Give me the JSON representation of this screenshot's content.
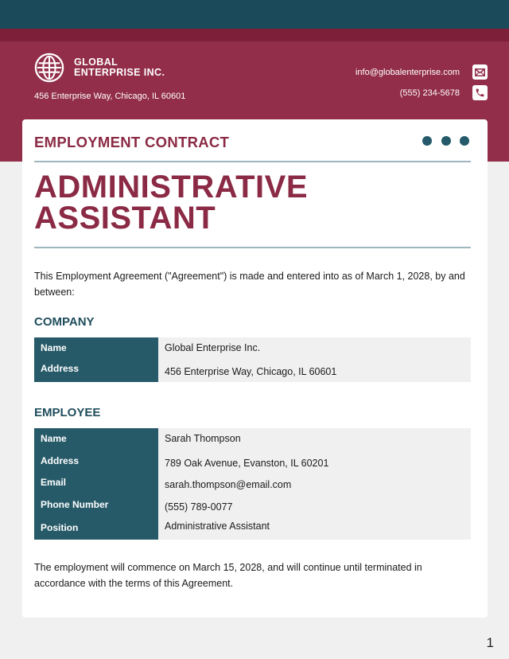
{
  "header": {
    "company_name_line1": "GLOBAL",
    "company_name_line2": "ENTERPRISE INC.",
    "logo_icon": "globe-icon",
    "address": "456 Enterprise Way, Chicago, IL 60601",
    "email": "info@globalenterprise.com",
    "email_icon": "envelope-icon",
    "phone": "(555) 234-5678",
    "phone_icon": "phone-icon"
  },
  "document": {
    "type_label": "EMPLOYMENT CONTRACT",
    "title_line1": "ADMINISTRATIVE",
    "title_line2": "ASSISTANT",
    "intro": "This Employment Agreement (\"Agreement\") is made and entered into as of March 1, 2028, by and between:",
    "company_section": {
      "title": "COMPANY",
      "rows": [
        {
          "label": "Name",
          "value": "Global Enterprise Inc."
        },
        {
          "label": "Address",
          "value": "456 Enterprise Way, Chicago, IL 60601"
        }
      ]
    },
    "employee_section": {
      "title": "EMPLOYEE",
      "rows": [
        {
          "label": "Name",
          "value": "Sarah Thompson"
        },
        {
          "label": "Address",
          "value": "789 Oak Avenue, Evanston, IL 60201"
        },
        {
          "label": "Email",
          "value": "sarah.thompson@email.com"
        },
        {
          "label": "Phone Number",
          "value": "(555) 789-0077"
        },
        {
          "label": "Position",
          "value": "Administrative Assistant"
        }
      ]
    },
    "closing": "The employment will commence on March 15, 2028, and will continue until terminated in accordance with the terms of this Agreement."
  },
  "page_number": "1",
  "colors": {
    "top_band": "#1b4a5a",
    "mid_band": "#7e1f3a",
    "header_bg": "#922e4a",
    "accent_maroon": "#8b2a45",
    "accent_teal": "#265a68",
    "page_bg": "#f0f0f0"
  }
}
